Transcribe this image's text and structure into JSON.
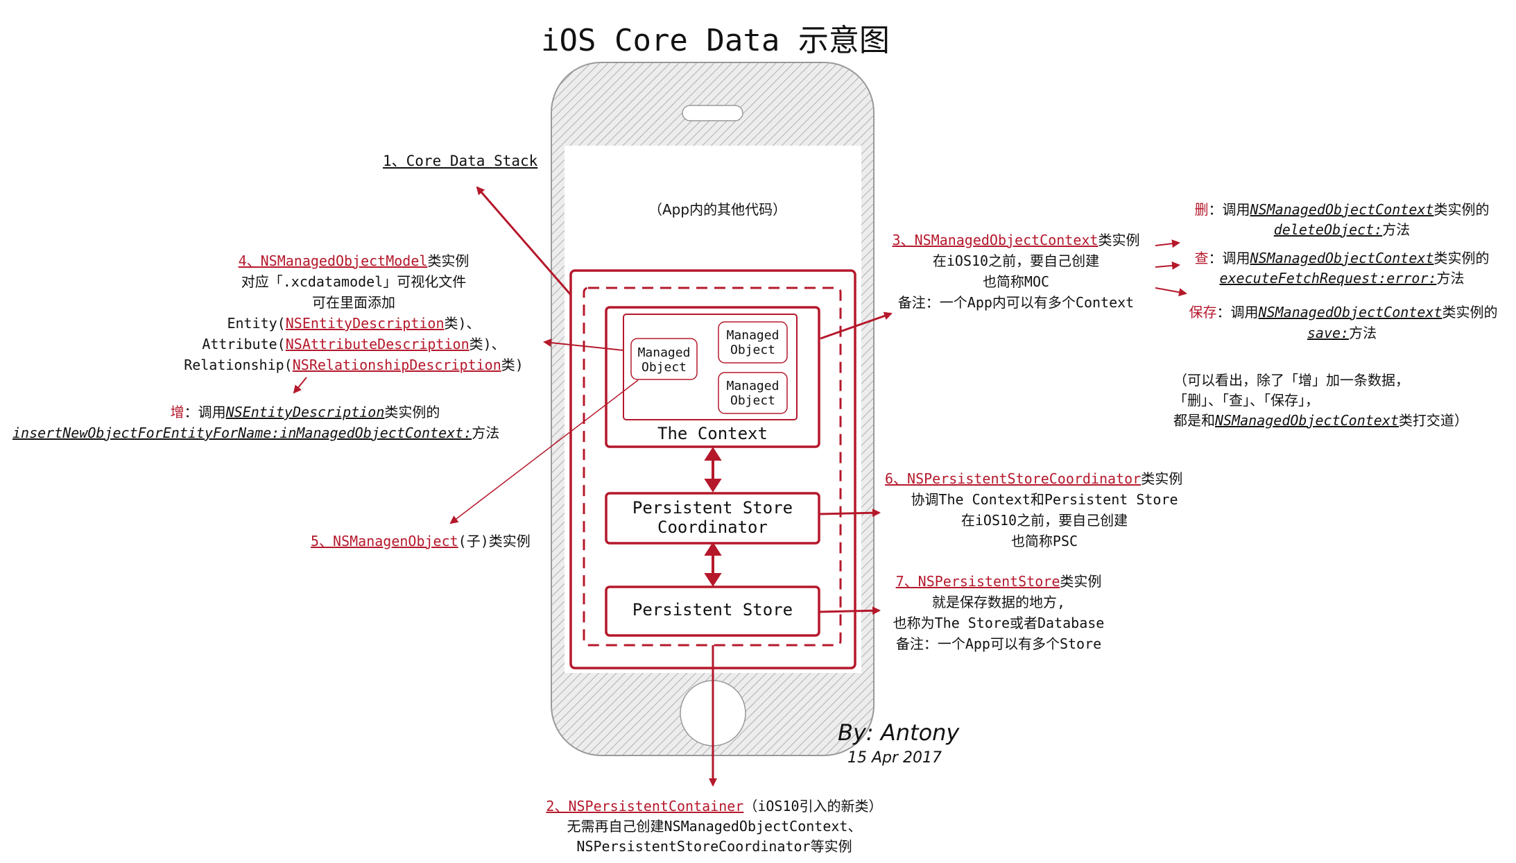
{
  "title": "iOS Core Data 示意图",
  "app_other_code": "（App内的其他代码）",
  "phone": {
    "managed_object": "Managed\nObject",
    "the_context": "The Context",
    "psc": "Persistent Store\nCoordinator",
    "persistent_store": "Persistent Store"
  },
  "labels": {
    "core_data_stack": "1、Core Data Stack",
    "container_1_prefix": "2、",
    "container_1_link": "NSPersistentContainer",
    "container_1_suffix": "（iOS10引入的新类）",
    "container_2": "无需再自己创建NSManagedObjectContext、",
    "container_3": "NSPersistentStoreCoordinator等实例",
    "moc_1_prefix": "3、",
    "moc_1_link": "NSManagedObjectContext",
    "moc_1_suffix": "类实例",
    "moc_2": "在iOS10之前，要自己创建",
    "moc_3": "也简称MOC",
    "moc_4": "备注：一个App内可以有多个Context",
    "model_1_prefix": "4、",
    "model_1_link": "NSManagedObjectModel",
    "model_1_suffix": "类实例",
    "model_2": "对应「.xcdatamodel」可视化文件",
    "model_3": "可在里面添加",
    "model_4_prefix": "Entity(",
    "model_4_link": "NSEntityDescription",
    "model_4_suffix": "类)、",
    "model_5_prefix": "Attribute(",
    "model_5_link": "NSAttributeDescription",
    "model_5_suffix": "类)、",
    "model_6_prefix": "Relationship(",
    "model_6_link": "NSRelationshipDescription",
    "model_6_suffix": "类)",
    "add_1_label": "增",
    "add_1_mid": "：调用",
    "add_1_link": "NSEntityDescription",
    "add_1_suffix": "类实例的",
    "add_2_link": "insertNewObjectForEntityForName:inManagedObjectContext:",
    "add_2_suffix": "方法",
    "mo_prefix": "5、",
    "mo_link": "NSManagenObject",
    "mo_suffix": "(子)类实例",
    "psc_1_prefix": "6、",
    "psc_1_link": "NSPersistentStoreCoordinator",
    "psc_1_suffix": "类实例",
    "psc_2": "协调The Context和Persistent Store",
    "psc_3": "在iOS10之前，要自己创建",
    "psc_4": "也简称PSC",
    "ps_1_prefix": "7、",
    "ps_1_link": "NSPersistentStore",
    "ps_1_suffix": "类实例",
    "ps_2": "就是保存数据的地方,",
    "ps_3": "也称为The Store或者Database",
    "ps_4": "备注：一个App可以有多个Store",
    "del_label": "删",
    "del_mid": "：调用",
    "del_link": "NSManagedObjectContext",
    "del_suffix": "类实例的",
    "del_method": "deleteObject:",
    "del_method_suffix": "方法",
    "fetch_label": "查",
    "fetch_mid": "：调用",
    "fetch_link": "NSManagedObjectContext",
    "fetch_suffix": "类实例的",
    "fetch_method": "executeFetchRequest:error:",
    "fetch_method_suffix": "方法",
    "save_label": "保存",
    "save_mid": "：调用",
    "save_link": "NSManagedObjectContext",
    "save_suffix": "类实例的",
    "save_method": "save:",
    "save_method_suffix": "方法",
    "note_1": "（可以看出，除了「增」加一条数据，",
    "note_2": "「删」、「查」、「保存」，",
    "note_3_prefix": "都是和",
    "note_3_link": "NSManagedObjectContext",
    "note_3_suffix": "类打交道）"
  },
  "byline": "By: Antony",
  "date": "15 Apr 2017",
  "colors": {
    "accent": "#b5182b",
    "ink": "#111111",
    "phone_hatch": "#b8b8b8"
  }
}
